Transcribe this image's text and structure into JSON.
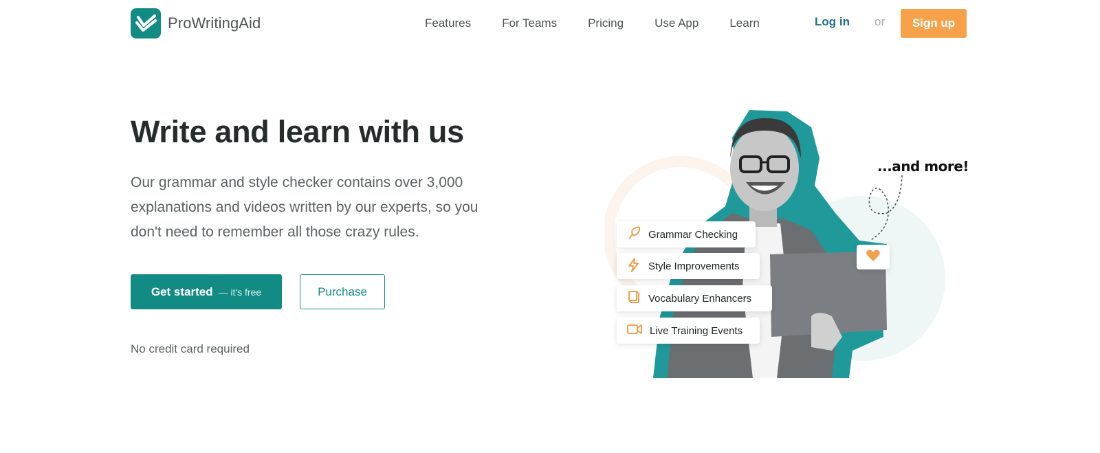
{
  "brand": {
    "name": "ProWritingAid",
    "accent": "#138b85",
    "cta_color": "#f7a24b"
  },
  "nav": {
    "items": [
      {
        "label": "Features"
      },
      {
        "label": "For Teams"
      },
      {
        "label": "Pricing"
      },
      {
        "label": "Use App"
      },
      {
        "label": "Learn"
      }
    ],
    "login": "Log in",
    "or": "or",
    "signup": "Sign up"
  },
  "hero": {
    "title": "Write and learn with us",
    "description": "Our grammar and style checker contains over 3,000 explanations and videos written by our experts, so you don't need to remember all those crazy rules.",
    "primary_cta": "Get started",
    "primary_cta_sub": "— it's free",
    "secondary_cta": "Purchase",
    "note": "No credit card required"
  },
  "illustration": {
    "features": [
      {
        "label": "Grammar Checking",
        "icon": "quill-icon"
      },
      {
        "label": "Style Improvements",
        "icon": "lightning-icon"
      },
      {
        "label": "Vocabulary Enhancers",
        "icon": "book-icon"
      },
      {
        "label": "Live Training Events",
        "icon": "video-camera-icon"
      }
    ],
    "more": "...and more!",
    "heart_icon": "heart-icon"
  }
}
